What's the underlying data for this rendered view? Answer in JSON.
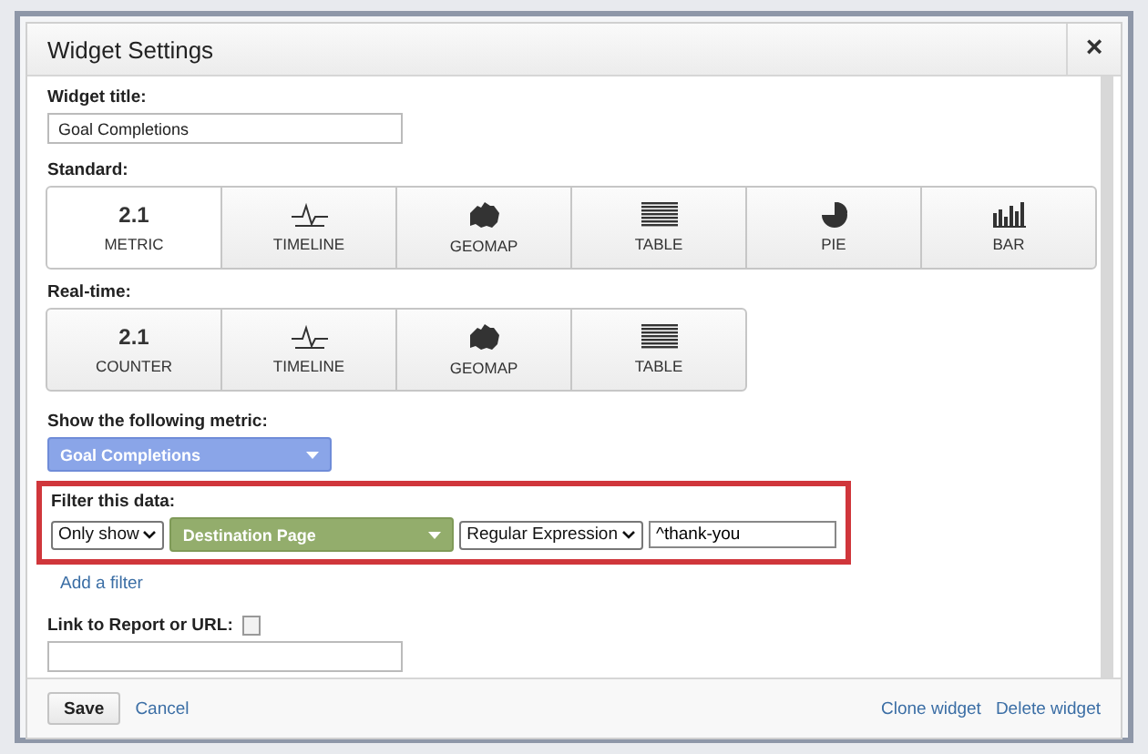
{
  "window": {
    "title": "Widget Settings",
    "close": "×"
  },
  "widget_title": {
    "label": "Widget title:",
    "value": "Goal Completions"
  },
  "standard": {
    "label": "Standard:",
    "options": [
      {
        "kind": "number",
        "glyph": "2.1",
        "label": "METRIC",
        "selected": true
      },
      {
        "kind": "timeline",
        "label": "TIMELINE",
        "selected": false
      },
      {
        "kind": "geomap",
        "label": "GEOMAP",
        "selected": false
      },
      {
        "kind": "table",
        "label": "TABLE",
        "selected": false
      },
      {
        "kind": "pie",
        "label": "PIE",
        "selected": false
      },
      {
        "kind": "bar",
        "label": "BAR",
        "selected": false
      }
    ]
  },
  "realtime": {
    "label": "Real-time:",
    "options": [
      {
        "kind": "number",
        "glyph": "2.1",
        "label": "COUNTER",
        "selected": false
      },
      {
        "kind": "timeline",
        "label": "TIMELINE",
        "selected": false
      },
      {
        "kind": "geomap",
        "label": "GEOMAP",
        "selected": false
      },
      {
        "kind": "table",
        "label": "TABLE",
        "selected": false
      }
    ]
  },
  "metric": {
    "label": "Show the following metric:",
    "value": "Goal Completions"
  },
  "filter": {
    "label": "Filter this data:",
    "mode": "Only show",
    "dimension": "Destination Page",
    "match": "Regular Expression",
    "value": "^thank-you",
    "highlighted": true
  },
  "add_filter": "Add a filter",
  "link": {
    "label": "Link to Report or URL:",
    "checked": false
  },
  "footer": {
    "save": "Save",
    "cancel": "Cancel",
    "clone": "Clone widget",
    "delete": "Delete widget"
  }
}
